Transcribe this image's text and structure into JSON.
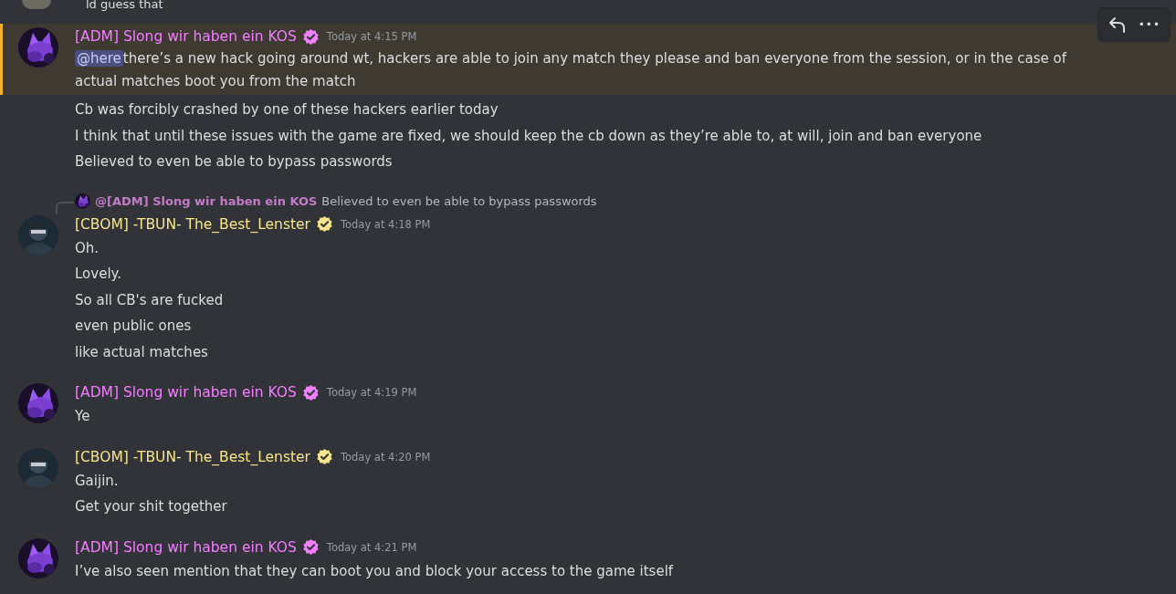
{
  "previous_line": "ld guess that",
  "toolbar": {
    "reply": true,
    "more": "•••"
  },
  "messages": [
    {
      "kind": "full",
      "author": {
        "name": "[ADM] Slong wir haben ein KOS",
        "color": "#f47fff",
        "kind": "cat"
      },
      "time": "Today at 4:15 PM",
      "highlighted": true,
      "lines": [
        {
          "mention": "@here",
          "text": "there’s a new hack going around wt, hackers are able to join any match they please and ban everyone from the session, or in the case of actual matches boot you from the match"
        }
      ]
    },
    {
      "kind": "continuation",
      "highlighted": false,
      "lines": [
        {
          "text": "Cb was forcibly crashed by one of these hackers earlier today"
        },
        {
          "text": "I think that until these issues with the game are fixed, we should keep the cb down as they’re able to, at will, join and ban everyone"
        },
        {
          "text": "Believed to even be able to bypass passwords"
        }
      ]
    },
    {
      "kind": "full",
      "author": {
        "name": "[CBOM] -TBUN- The_Best_Lenster",
        "color": "#f8e58c",
        "kind": "figure"
      },
      "time": "Today at 4:18 PM",
      "highlighted": false,
      "reply": {
        "author": "@[ADM] Slong wir haben ein KOS",
        "color": "#c27cc7",
        "kind": "cat",
        "text": "Believed to even be able to bypass passwords"
      },
      "lines": [
        {
          "text": "Oh."
        },
        {
          "text": "Lovely."
        },
        {
          "text": "So all CB's are fucked"
        },
        {
          "text": "even public ones"
        },
        {
          "text": "like actual matches"
        }
      ]
    },
    {
      "kind": "full",
      "author": {
        "name": "[ADM] Slong wir haben ein KOS",
        "color": "#f47fff",
        "kind": "cat"
      },
      "time": "Today at 4:19 PM",
      "highlighted": false,
      "lines": [
        {
          "text": "Ye"
        }
      ]
    },
    {
      "kind": "full",
      "author": {
        "name": "[CBOM] -TBUN- The_Best_Lenster",
        "color": "#f8e58c",
        "kind": "figure"
      },
      "time": "Today at 4:20 PM",
      "highlighted": false,
      "lines": [
        {
          "text": "Gaijin."
        },
        {
          "text": "Get your shit together"
        }
      ]
    },
    {
      "kind": "full",
      "author": {
        "name": "[ADM] Slong wir haben ein KOS",
        "color": "#f47fff",
        "kind": "cat"
      },
      "time": "Today at 4:21 PM",
      "highlighted": false,
      "lines": [
        {
          "text": "I’ve also seen mention that they can boot you and block your access to the game itself"
        }
      ]
    }
  ]
}
